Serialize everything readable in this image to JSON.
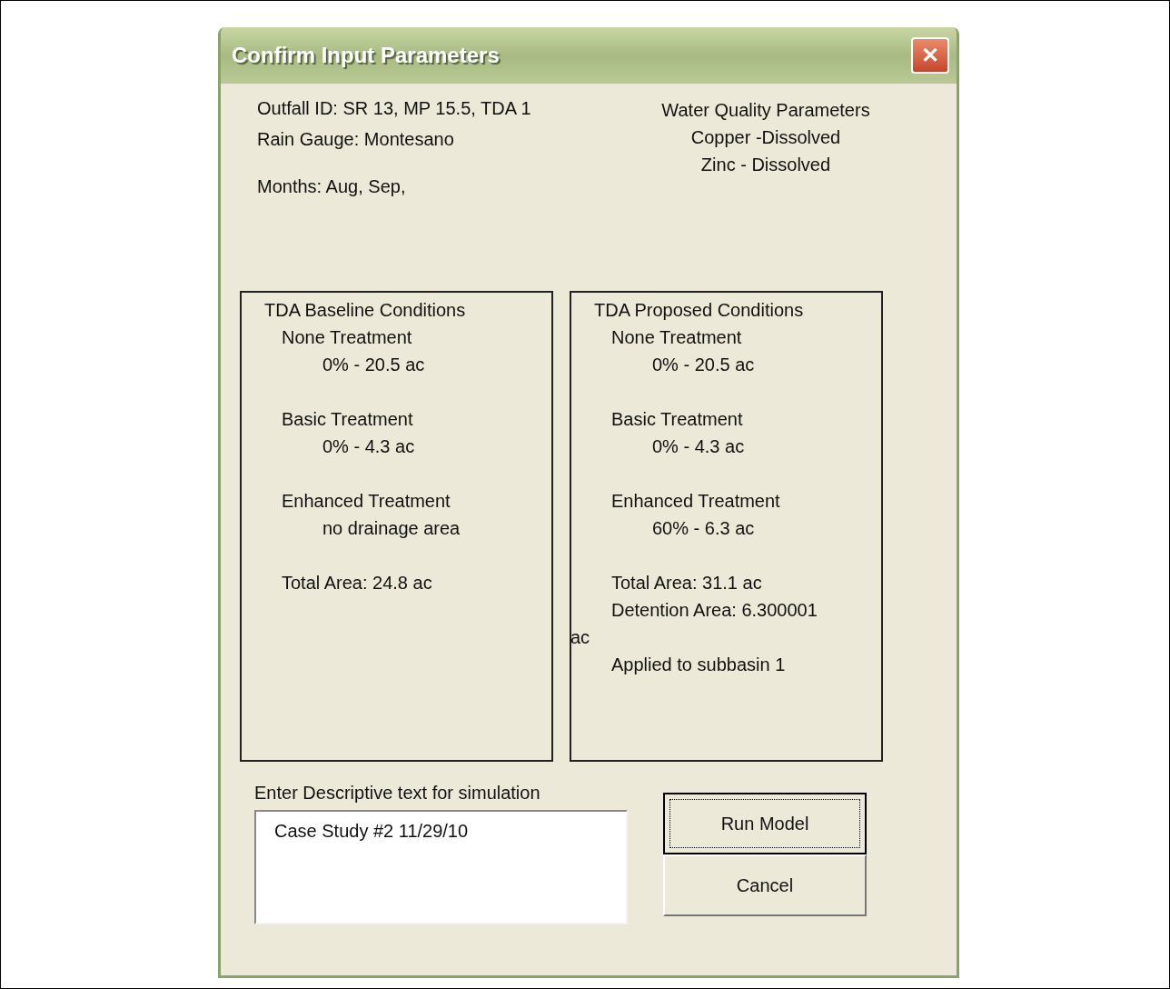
{
  "window": {
    "title": "Confirm Input Parameters",
    "close": "✕"
  },
  "info": {
    "lines": [
      "Outfall ID: SR 13, MP 15.5, TDA 1",
      "Rain Gauge: Montesano"
    ],
    "months": "Months: Aug, Sep,"
  },
  "water_quality": {
    "title": "Water Quality Parameters",
    "items": [
      "Copper -Dissolved",
      "Zinc - Dissolved"
    ]
  },
  "panels": [
    {
      "title": "TDA Baseline Conditions",
      "groups": [
        {
          "label": "None Treatment",
          "value": "0% - 20.5 ac"
        },
        {
          "label": "Basic Treatment",
          "value": "0% - 4.3 ac"
        },
        {
          "label": "Enhanced Treatment",
          "value": "no drainage area"
        }
      ],
      "totals": [
        {
          "kind": "line",
          "text": "Total Area: 24.8 ac"
        }
      ]
    },
    {
      "title": "TDA Proposed Conditions",
      "groups": [
        {
          "label": "None Treatment",
          "value": "0% - 20.5 ac"
        },
        {
          "label": "Basic Treatment",
          "value": "0% - 4.3 ac"
        },
        {
          "label": "Enhanced Treatment",
          "value": "60% - 6.3 ac"
        }
      ],
      "totals": [
        {
          "kind": "line",
          "text": "Total Area: 31.1 ac"
        },
        {
          "kind": "line",
          "text": "Detention Area: 6.300001"
        },
        {
          "kind": "wrap",
          "text": "ac"
        },
        {
          "kind": "line",
          "text": "Applied to subbasin 1"
        }
      ]
    }
  ],
  "description": {
    "label": "Enter Descriptive text for simulation",
    "value": "Case Study #2 11/29/10"
  },
  "buttons": [
    {
      "label": "Run Model",
      "focused": true
    },
    {
      "label": "Cancel",
      "focused": false
    }
  ]
}
